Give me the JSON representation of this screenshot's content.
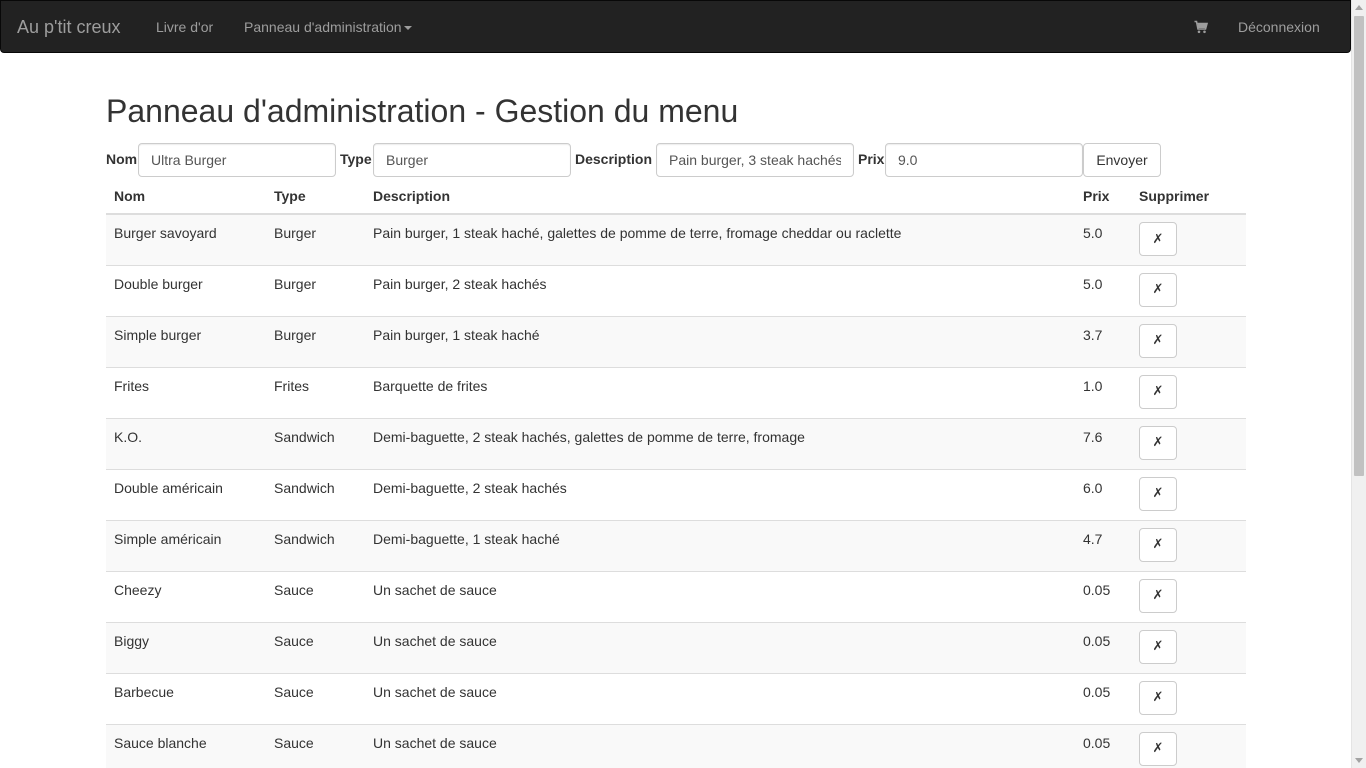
{
  "navbar": {
    "brand": "Au p'tit creux",
    "guestbook_link": "Livre d'or",
    "admin_menu": "Panneau d'administration",
    "logout_link": "Déconnexion"
  },
  "page": {
    "title": "Panneau d'administration - Gestion du menu"
  },
  "form": {
    "name_label": "Nom",
    "name_value": "Ultra Burger",
    "type_label": "Type",
    "type_value": "Burger",
    "description_label": "Description",
    "description_value": "Pain burger, 3 steak hachés",
    "price_label": "Prix",
    "price_value": "9.0",
    "submit_label": "Envoyer"
  },
  "table": {
    "headers": {
      "name": "Nom",
      "type": "Type",
      "description": "Description",
      "price": "Prix",
      "delete": "Supprimer"
    },
    "delete_symbol": "✗",
    "rows": [
      {
        "name": "Burger savoyard",
        "type": "Burger",
        "description": "Pain burger, 1 steak haché, galettes de pomme de terre, fromage cheddar ou raclette",
        "price": "5.0"
      },
      {
        "name": "Double burger",
        "type": "Burger",
        "description": "Pain burger, 2 steak hachés",
        "price": "5.0"
      },
      {
        "name": "Simple burger",
        "type": "Burger",
        "description": "Pain burger, 1 steak haché",
        "price": "3.7"
      },
      {
        "name": "Frites",
        "type": "Frites",
        "description": "Barquette de frites",
        "price": "1.0"
      },
      {
        "name": "K.O.",
        "type": "Sandwich",
        "description": "Demi-baguette, 2 steak hachés, galettes de pomme de terre, fromage",
        "price": "7.6"
      },
      {
        "name": "Double américain",
        "type": "Sandwich",
        "description": "Demi-baguette, 2 steak hachés",
        "price": "6.0"
      },
      {
        "name": "Simple américain",
        "type": "Sandwich",
        "description": "Demi-baguette, 1 steak haché",
        "price": "4.7"
      },
      {
        "name": "Cheezy",
        "type": "Sauce",
        "description": "Un sachet de sauce",
        "price": "0.05"
      },
      {
        "name": "Biggy",
        "type": "Sauce",
        "description": "Un sachet de sauce",
        "price": "0.05"
      },
      {
        "name": "Barbecue",
        "type": "Sauce",
        "description": "Un sachet de sauce",
        "price": "0.05"
      },
      {
        "name": "Sauce blanche",
        "type": "Sauce",
        "description": "Un sachet de sauce",
        "price": "0.05"
      }
    ]
  },
  "icons": {
    "cart": "shopping-cart-icon",
    "caret": "caret-down-icon"
  },
  "colors": {
    "navbar_bg": "#222222",
    "nav_text": "#9d9d9d",
    "striped_row": "#f9f9f9",
    "border": "#dddddd"
  }
}
